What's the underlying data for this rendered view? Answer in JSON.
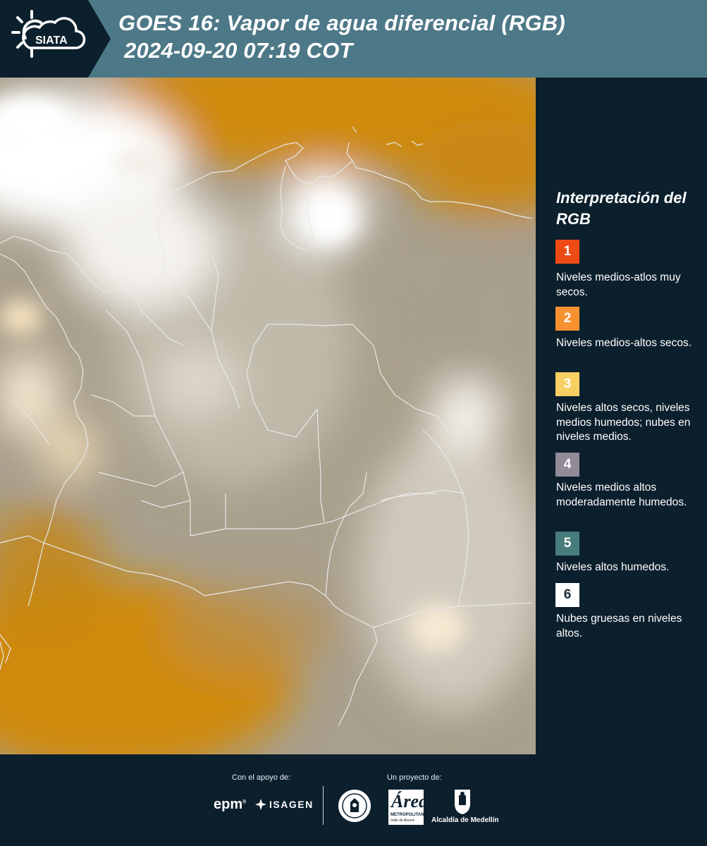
{
  "header": {
    "logo_text": "SIATA",
    "title_line1": "GOES 16: Vapor de agua diferencial (RGB)",
    "title_line2": "2024-09-20 07:19 COT",
    "background_color": "#4d7887"
  },
  "map": {
    "type": "satellite-rgb-image",
    "colors": {
      "dry_orange": "#cf8a0c",
      "moist_gray": "#a89f8c",
      "thick_clouds": "#ffffff",
      "borders": "#e4e4e4"
    }
  },
  "legend": {
    "title": "Interpretación del RGB",
    "items": [
      {
        "number": "1",
        "color": "#ef4a16",
        "number_color": "#ffffff",
        "text": "Niveles medios-atlos muy secos."
      },
      {
        "number": "2",
        "color": "#f5922f",
        "number_color": "#ffffff",
        "text": "Niveles medios-altos secos."
      },
      {
        "number": "3",
        "color": "#f7cf63",
        "number_color": "#ffffff",
        "text": "Niveles altos secos, niveles medios humedos; nubes en niveles medios."
      },
      {
        "number": "4",
        "color": "#918b9a",
        "number_color": "#ffffff",
        "text": "Niveles medios altos moderadamente humedos."
      },
      {
        "number": "5",
        "color": "#477c7a",
        "number_color": "#ffffff",
        "text": "Niveles altos humedos."
      },
      {
        "number": "6",
        "color": "#ffffff",
        "number_color": "#1c2a33",
        "text": "Nubes gruesas en niveles altos."
      }
    ]
  },
  "footer": {
    "support_label": "Con el apoyo de:",
    "project_label": "Un proyecto de:",
    "epm_logo_text": "epm",
    "isagen_logo_text": "ISAGEN",
    "area_logo_text": "Área",
    "area_logo_sub1": "METROPOLITANA",
    "area_logo_sub2": "Valle de Aburrá",
    "medellin_text": "Alcaldía de Medellín"
  }
}
